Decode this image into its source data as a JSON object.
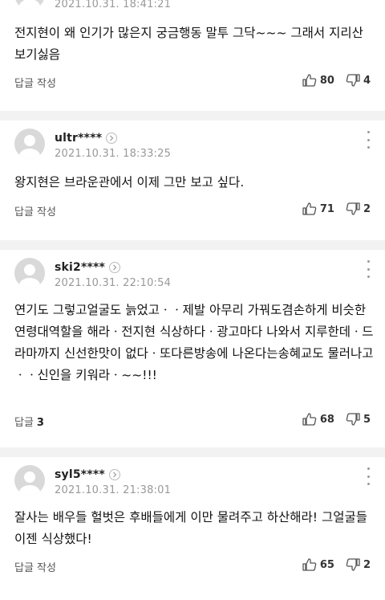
{
  "comments": [
    {
      "date": "2021.10.31. 18:41:21",
      "text": "전지현이 왜 인기가 많은지 궁금행동 말투 그닥~~~ 그래서 지리산 보기싫음",
      "reply_label": "답글 작성",
      "reply_count": "",
      "likes": "80",
      "dislikes": "4"
    },
    {
      "username": "ultr****",
      "date": "2021.10.31. 18:33:25",
      "text": "왕지현은 브라운관에서 이제 그만 보고 싶다.",
      "reply_label": "답글 작성",
      "reply_count": "",
      "likes": "71",
      "dislikes": "2"
    },
    {
      "username": "ski2****",
      "date": "2021.10.31. 22:10:54",
      "text": "연기도 그렇고얼굴도 늙었고ㆍㆍ제발 아무리 가꿔도겸손하게 비슷한 연령대역할을 해라ㆍ전지현 식상하다ㆍ광고마다 나와서 지루한데ㆍ드라마까지 신선한맛이 없다ㆍ또다른방송에 나온다는송혜교도 물러나고ㆍㆍ신인을 키워라ㆍ~~!!!",
      "reply_label": "답글",
      "reply_count": "3",
      "likes": "68",
      "dislikes": "5"
    },
    {
      "username": "syl5****",
      "date": "2021.10.31. 21:38:01",
      "text": "잘사는 배우들 헐벗은 후배들에게 이만 물려주고 하산해라! 그얼굴들 이젠 식상했다!",
      "reply_label": "답글 작성",
      "reply_count": "",
      "likes": "65",
      "dislikes": "2"
    }
  ]
}
